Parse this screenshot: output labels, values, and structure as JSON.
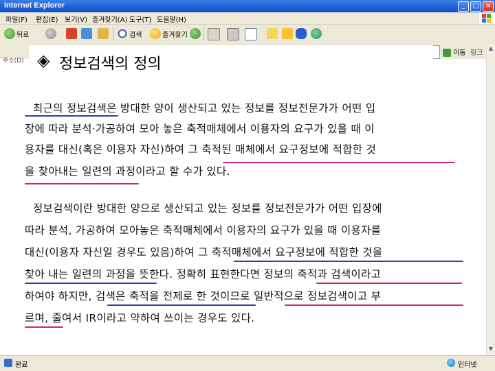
{
  "window": {
    "title": "Internet Explorer",
    "min": "_",
    "max": "□",
    "close": "×"
  },
  "menu": [
    "파일(F)",
    "편집(E)",
    "보기(V)",
    "즐겨찾기(A)",
    "도구(T)",
    "도움말(H)"
  ],
  "toolbar": {
    "back": "뒤로",
    "search": "검색",
    "favorites": "즐겨찾기"
  },
  "address": {
    "label": "주소(D)",
    "go": "이동",
    "links": "링크"
  },
  "slide": {
    "title": "정보검색의 정의",
    "para1": [
      "최근의 정보검색은 방대한 양이 생산되고 있는 정보를 정보전문가가 어떤 입",
      "장에 따라 분석·가공하여 모아 놓은 축적매체에서 이용자의 요구가 있을 때 이",
      "용자를 대신(혹은 이용자 자신)하여 그 축적된 매체에서 요구정보에 적합한 것",
      "을 찾아내는 일련의 과정이라고 할 수가 있다."
    ],
    "para2": [
      "정보검색이란 방대한 양으로 생산되고 있는 정보를 정보전문가가 어떤 입장에",
      "따라 분석, 가공하여 모아놓은 축적매체에서 이용자의 요구가 있을 때 이용자를",
      "대신(이용자 자신일 경우도 있음)하여 그 축적매체에서 요구정보에 적합한 것을",
      "찾아 내는 일련의 과정을 뜻한다. 정확히 표현한다면 정보의 축적과 검색이라고",
      "하여야 하지만, 검색은 축적을 전제로 한 것이므로 일반적으로 정보검색이고 부",
      "르며, 줄여서 IR이라고 약하여 쓰이는 경우도 있다."
    ]
  },
  "status": {
    "done": "완료",
    "zone": "인터넷"
  },
  "colors": {
    "underline_blue": "#2b3fa8",
    "underline_pink": "#cc2272",
    "titlebar": "#1f5fd6"
  }
}
